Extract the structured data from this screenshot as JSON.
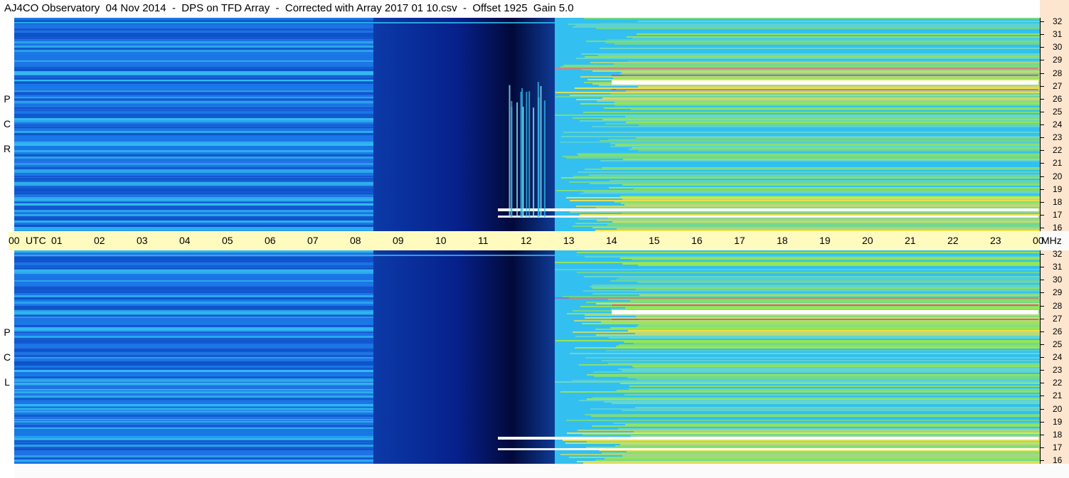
{
  "title": "AJ4CO Observatory  04 Nov 2014  -  DPS on TFD Array  -  Corrected with Array 2017 01 10.csv  -  Offset 1925  Gain 5.0",
  "panels": [
    {
      "polarization_letters": [
        "P",
        "C",
        "R"
      ],
      "name": "RCP"
    },
    {
      "polarization_letters": [
        "P",
        "C",
        "L"
      ],
      "name": "LCP"
    }
  ],
  "utc_axis": {
    "ticks": [
      "00",
      "UTC",
      "01",
      "02",
      "03",
      "04",
      "05",
      "06",
      "07",
      "08",
      "09",
      "10",
      "11",
      "12",
      "13",
      "14",
      "15",
      "16",
      "17",
      "18",
      "19",
      "20",
      "21",
      "22",
      "23",
      "00",
      "MHz"
    ]
  },
  "freq_axis": {
    "labels": [
      "32",
      "31",
      "30",
      "29",
      "28",
      "27",
      "26",
      "25",
      "24",
      "23",
      "22",
      "21",
      "20",
      "19",
      "18",
      "17",
      "16"
    ]
  },
  "colors": {
    "deep_blue": "#0a2a9a",
    "blue": "#1f6fe0",
    "cyan": "#33c0f0",
    "green": "#9ee84a",
    "yellow": "#f2e24a",
    "magenta": "#e0308a",
    "white": "#ffffff",
    "axis_bg": "#fde6cf",
    "utc_bg": "#fffbbf"
  },
  "chart_data": {
    "type": "heatmap",
    "title": "AJ4CO Observatory  04 Nov 2014  -  DPS on TFD Array  -  Corrected with Array 2017 01 10.csv  -  Offset 1925  Gain 5.0",
    "xlabel": "UTC",
    "ylabel": "MHz",
    "xlim": [
      0,
      24
    ],
    "ylim": [
      16,
      32
    ],
    "panels": [
      "RCP",
      "LCP"
    ]
  }
}
